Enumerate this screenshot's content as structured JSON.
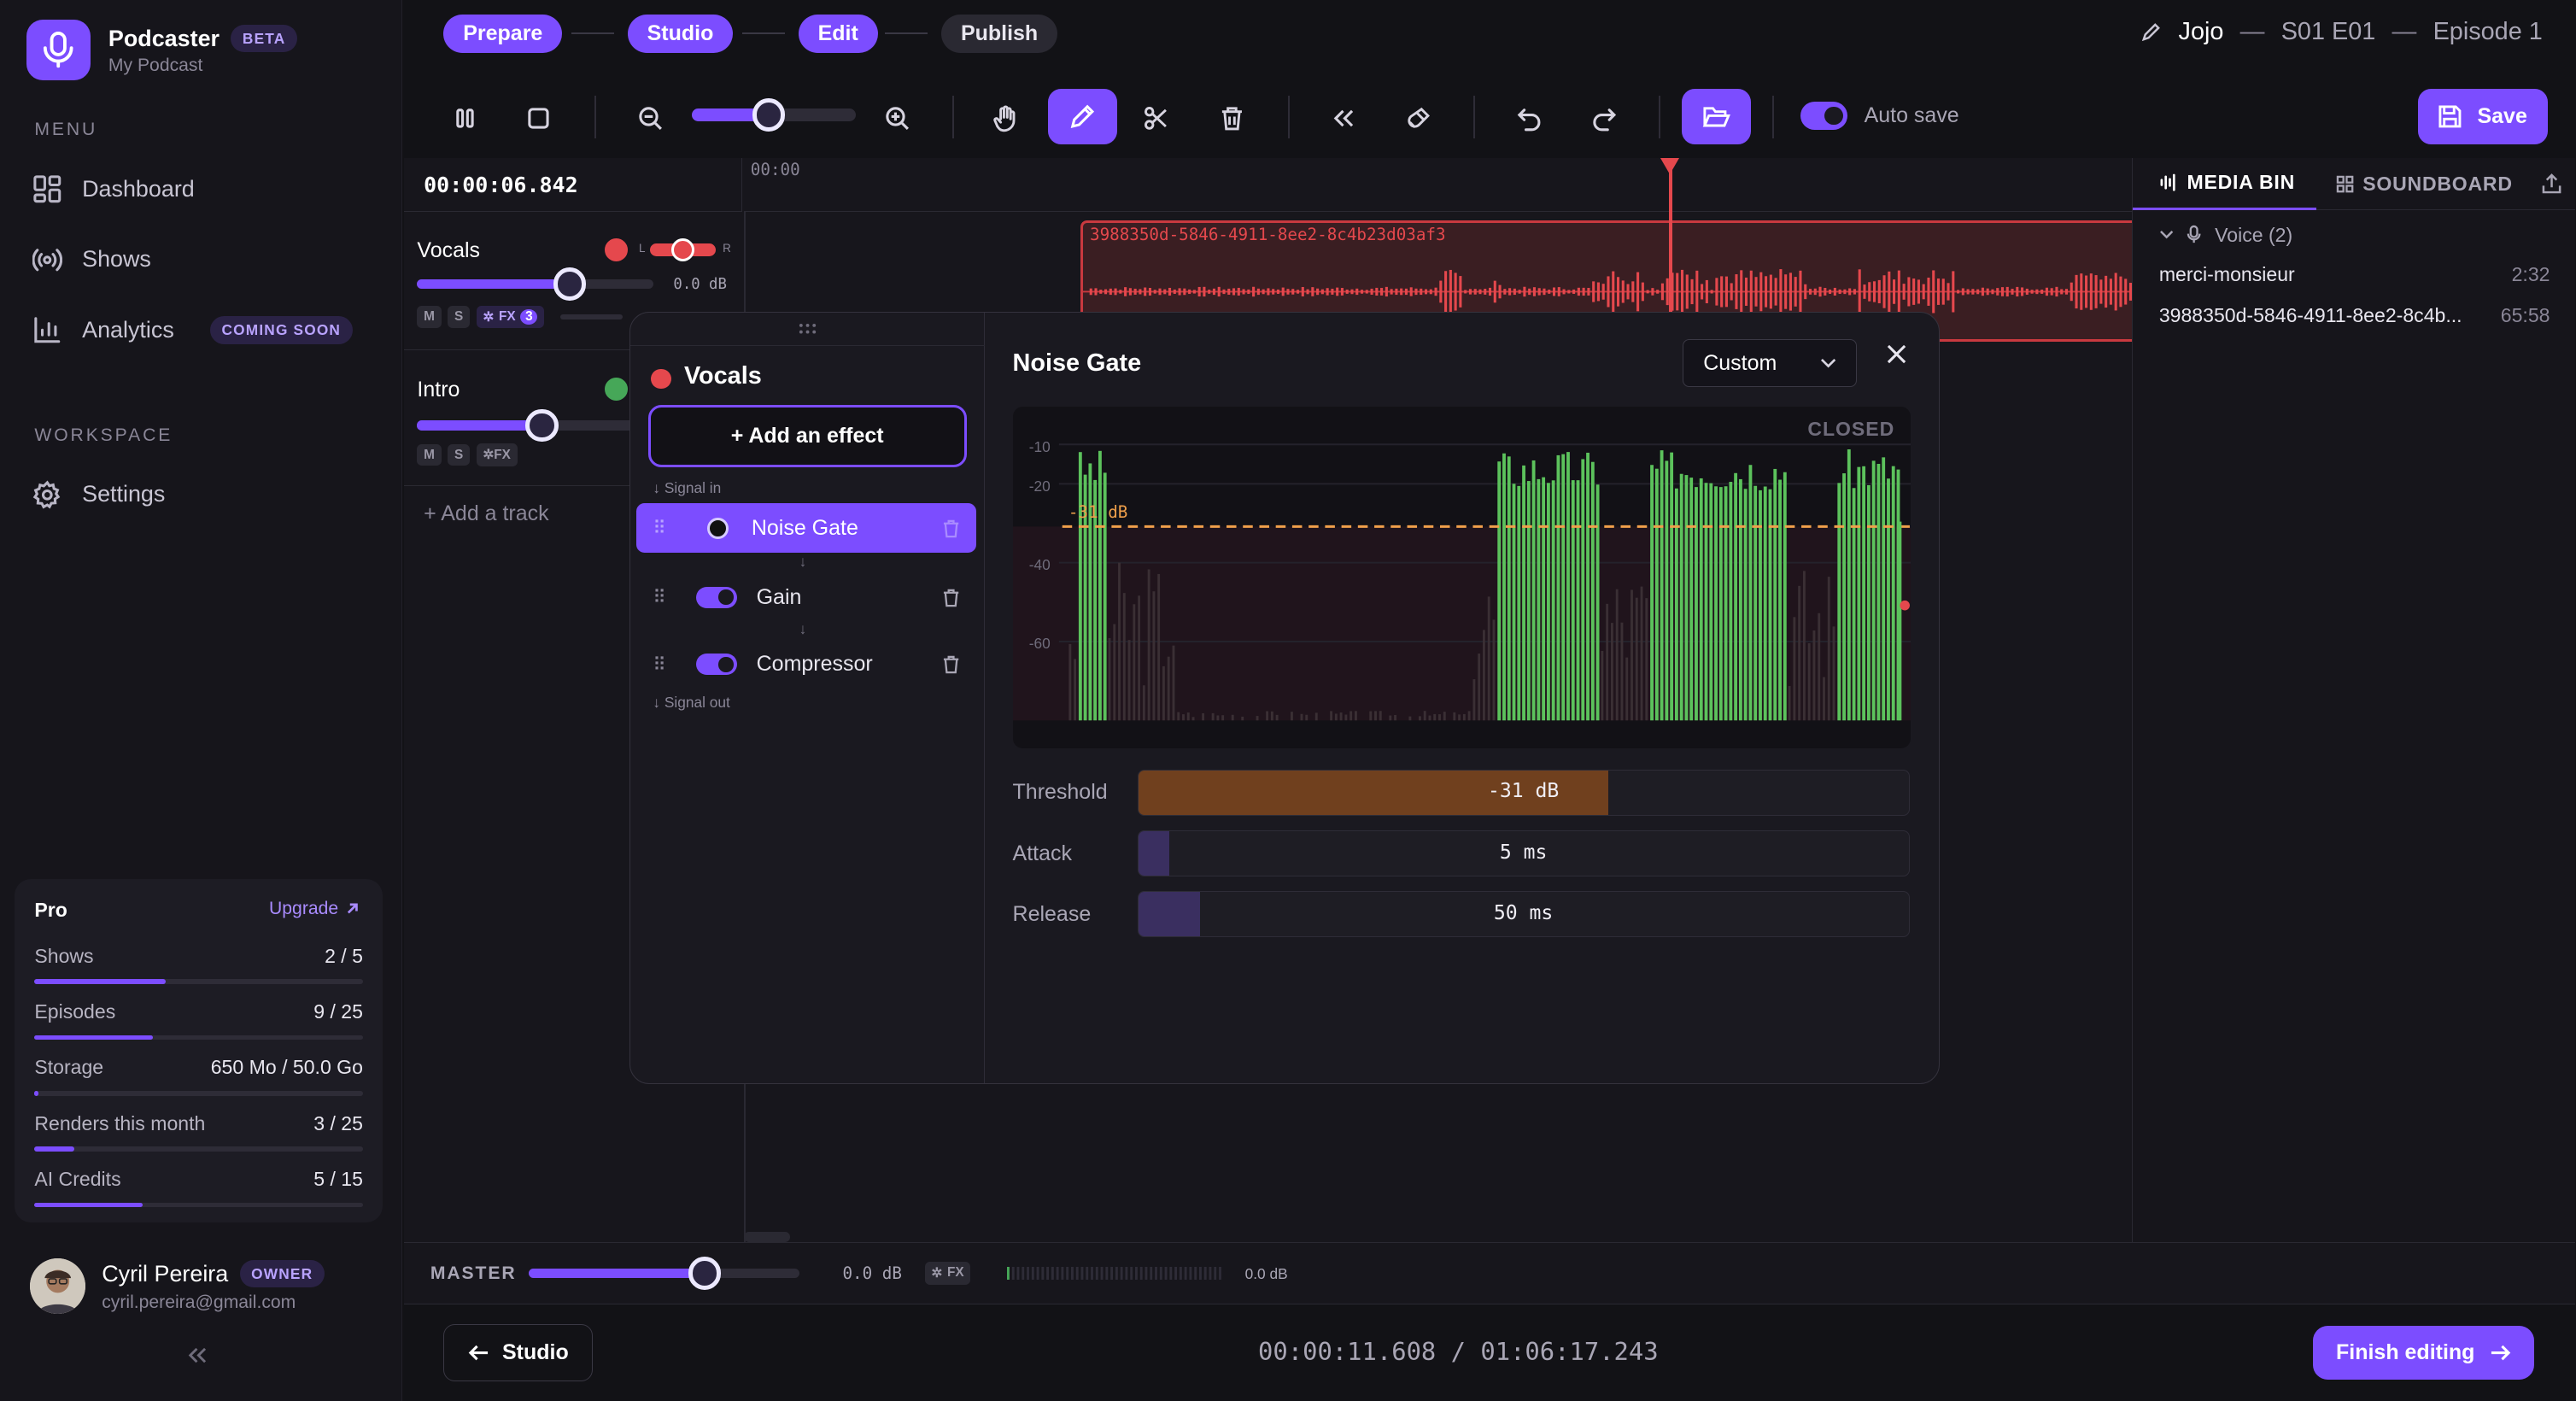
{
  "app": {
    "name": "Podcaster",
    "badge": "BETA",
    "podcast": "My Podcast"
  },
  "sidebar": {
    "menu_title": "MENU",
    "items": [
      {
        "label": "Dashboard",
        "icon": "grid-icon"
      },
      {
        "label": "Shows",
        "icon": "broadcast-icon"
      },
      {
        "label": "Analytics",
        "icon": "bar-chart-icon",
        "badge": "COMING SOON"
      }
    ],
    "workspace_title": "WORKSPACE",
    "workspace_items": [
      {
        "label": "Settings",
        "icon": "gear-icon"
      }
    ],
    "collapse_icon": "double-chevron-left-icon"
  },
  "plan": {
    "name": "Pro",
    "upgrade_label": "Upgrade",
    "usage": [
      {
        "label": "Shows",
        "value": "2 / 5",
        "fraction": 0.4
      },
      {
        "label": "Episodes",
        "value": "9 / 25",
        "fraction": 0.36
      },
      {
        "label": "Storage",
        "value": "650 Mo / 50.0 Go",
        "fraction": 0.013
      },
      {
        "label": "Renders this month",
        "value": "3 / 25",
        "fraction": 0.12
      },
      {
        "label": "AI Credits",
        "value": "5 / 15",
        "fraction": 0.33
      }
    ]
  },
  "user": {
    "name": "Cyril Pereira",
    "role": "OWNER",
    "email": "cyril.pereira@gmail.com"
  },
  "steps": [
    "Prepare",
    "Studio",
    "Edit",
    "Publish"
  ],
  "episode": {
    "show": "Jojo",
    "sep": "—",
    "code": "S01 E01",
    "title": "Episode 1"
  },
  "toolbar": {
    "autosave_label": "Auto save",
    "save_label": "Save"
  },
  "timeline": {
    "time": "00:00:06.842",
    "ruler_start": "00:00",
    "tracks": [
      {
        "name": "Vocals",
        "color": "#e5484d",
        "db": "0.0 dB",
        "fx_count": "3",
        "volume": 0.65
      },
      {
        "name": "Intro",
        "color": "#46a758",
        "volume": 0.52
      }
    ],
    "clip_label": "3988350d-5846-4911-8ee2-8c4b23d03af3",
    "add_track": "+ Add a track",
    "buttons": {
      "mute": "M",
      "solo": "S",
      "fx": "FX",
      "pan_l": "L",
      "pan_r": "R"
    }
  },
  "modal": {
    "track_name": "Vocals",
    "add_effect": "+ Add an effect",
    "signal_in": "Signal in",
    "signal_out": "Signal out",
    "effects": [
      {
        "name": "Noise Gate",
        "active": true
      },
      {
        "name": "Gain",
        "active": false
      },
      {
        "name": "Compressor",
        "active": false
      }
    ],
    "effect_title": "Noise Gate",
    "preset": "Custom",
    "state": "CLOSED",
    "threshold_marker": "-31 dB",
    "y_ticks": [
      "-10",
      "-20",
      "-40",
      "-60"
    ],
    "params": [
      {
        "label": "Threshold",
        "value": "-31 dB",
        "fraction": 0.61
      },
      {
        "label": "Attack",
        "value": "5 ms",
        "fraction": 0.04
      },
      {
        "label": "Release",
        "value": "50 ms",
        "fraction": 0.08
      }
    ]
  },
  "media": {
    "tabs": [
      "MEDIA BIN",
      "SOUNDBOARD"
    ],
    "group": "Voice (2)",
    "files": [
      {
        "name": "merci-monsieur",
        "duration": "2:32"
      },
      {
        "name": "3988350d-5846-4911-8ee2-8c4b...",
        "duration": "65:58"
      }
    ]
  },
  "master": {
    "label": "MASTER",
    "db": "0.0 dB",
    "fx": "FX",
    "meter_db": "0.0 dB",
    "volume": 0.65
  },
  "footer": {
    "back_label": "Studio",
    "position": "00:00:11.608 / 01:06:17.243",
    "finish_label": "Finish editing"
  },
  "colors": {
    "accent": "#7c4dff",
    "track_red": "#e5484d",
    "track_green": "#46a758",
    "gate_bar": "#5cc25c",
    "threshold": "#f0a04b"
  }
}
